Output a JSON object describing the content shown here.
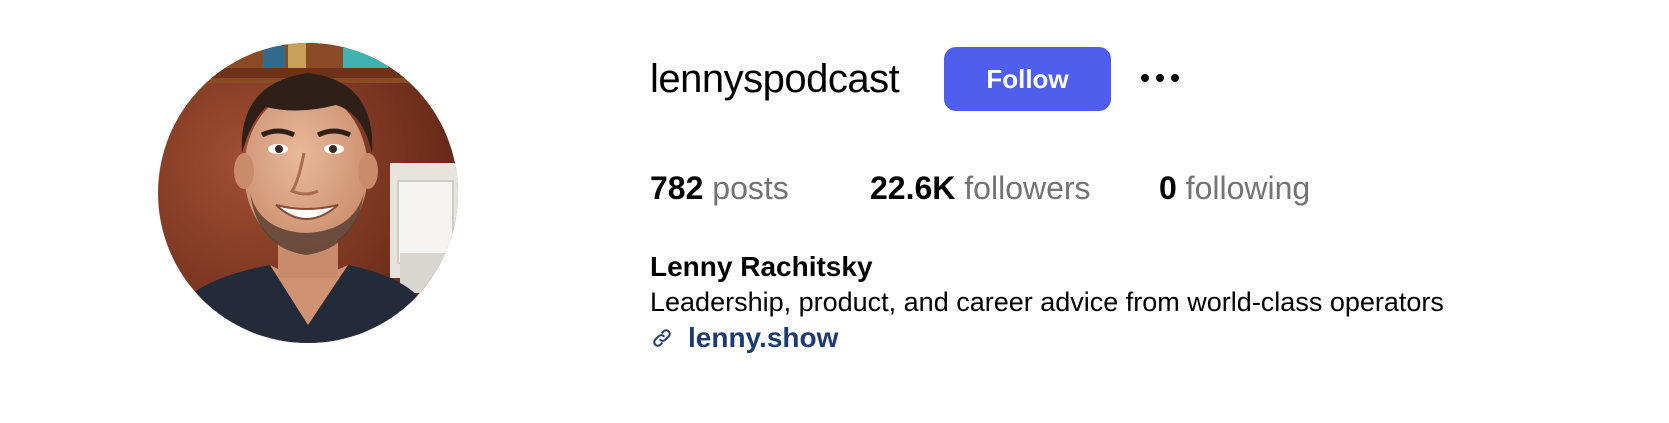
{
  "profile": {
    "username": "lennyspodcast",
    "follow_label": "Follow",
    "more_icon": "more-horizontal-icon",
    "avatar_icon": "profile-photo",
    "stats": [
      {
        "count": "782",
        "label": "posts"
      },
      {
        "count": "22.6K",
        "label": "followers"
      },
      {
        "count": "0",
        "label": "following"
      }
    ],
    "full_name": "Lenny Rachitsky",
    "bio": "Leadership, product, and career advice from world-class operators",
    "link_icon": "link-icon",
    "website": "lenny.show"
  },
  "colors": {
    "accent": "#4f5eed",
    "link": "#1d3b72",
    "muted_text": "#737373",
    "background": "#ffffff"
  }
}
